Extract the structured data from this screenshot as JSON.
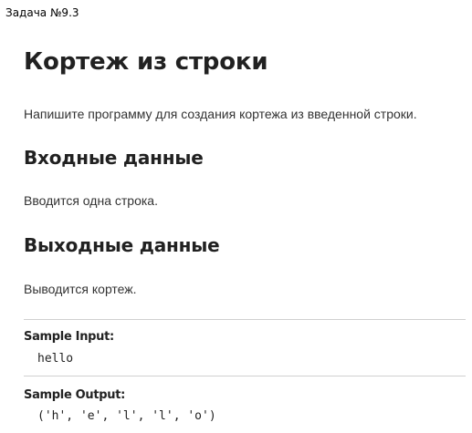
{
  "task_label": "Задача №9.3",
  "problem": {
    "title": "Кортеж из строки",
    "statement": "Напишите программу для создания кортежа из введенной строки."
  },
  "input_section": {
    "heading": "Входные данные",
    "text": "Вводится одна строка."
  },
  "output_section": {
    "heading": "Выходные данные",
    "text": "Выводится кортеж."
  },
  "samples": {
    "input_label": "Sample Input:",
    "input_value": "hello",
    "output_label": "Sample Output:",
    "output_value": "('h', 'e', 'l', 'l', 'o')"
  }
}
